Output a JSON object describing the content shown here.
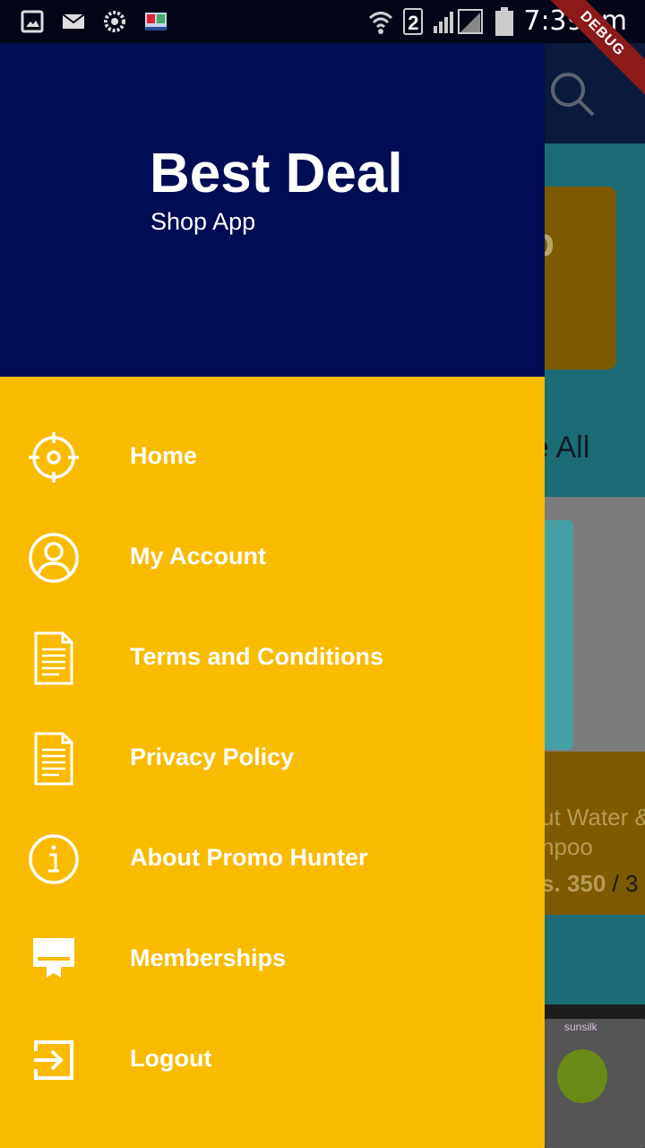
{
  "status_bar": {
    "time": "7:39pm",
    "sim_slot": "2",
    "debug_label": "DEBUG",
    "icons": [
      "image-icon",
      "mail-icon",
      "settings-gear-icon",
      "book-icon",
      "wifi-icon",
      "signal-icon",
      "battery-icon"
    ]
  },
  "drawer": {
    "title": "Best Deal",
    "subtitle": "Shop App",
    "colors": {
      "header": "#000c54",
      "body": "#f9bb00"
    },
    "items": [
      {
        "label": "Home",
        "icon": "crosshair-icon"
      },
      {
        "label": "My Account",
        "icon": "account-icon"
      },
      {
        "label": "Terms and Conditions",
        "icon": "document-icon"
      },
      {
        "label": "Privacy Policy",
        "icon": "document-icon"
      },
      {
        "label": "About Promo Hunter",
        "icon": "info-icon"
      },
      {
        "label": "Memberships",
        "icon": "membership-card-icon"
      },
      {
        "label": "Logout",
        "icon": "logout-icon"
      }
    ]
  },
  "background": {
    "card_text": "p",
    "see_all": "e All",
    "product_name_line1": "ut Water &",
    "product_name_line2": "npoo",
    "price": "s. 350",
    "price_slash": "/",
    "price_tail": "3",
    "thumb_brand": "sunsilk"
  }
}
